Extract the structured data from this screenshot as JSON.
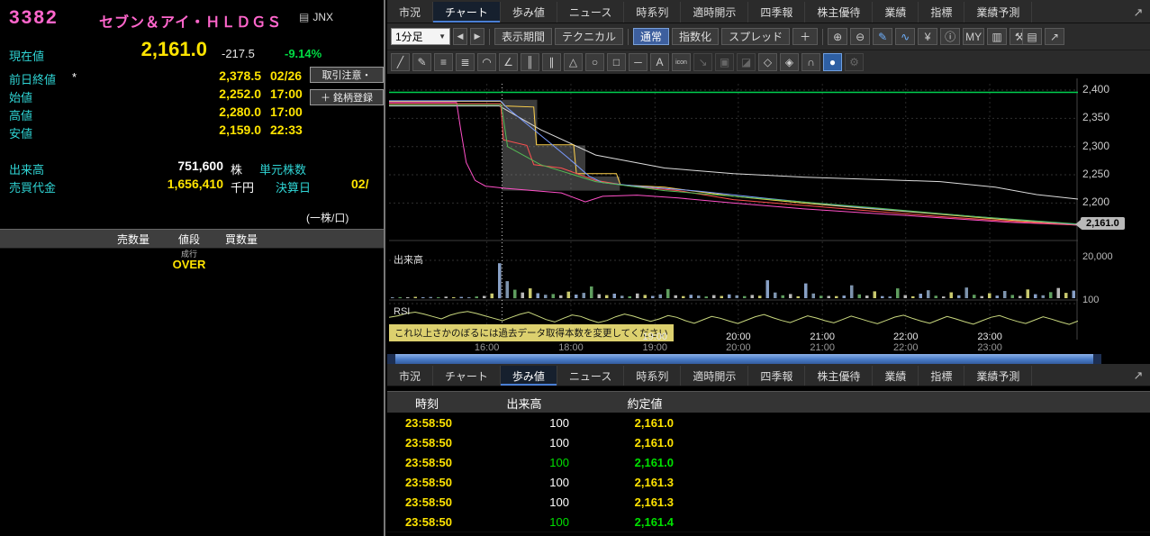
{
  "left": {
    "code": "3382",
    "name": "セブン＆アイ・ＨＬＤＧＳ",
    "board_icon": "▤",
    "exchange": "JNX",
    "current_label": "現在値",
    "current_value": "2,161.0",
    "change": "-217.5",
    "change_pct": "-9.14%",
    "info_rows": [
      {
        "label": "前日終値",
        "mark": "*",
        "value": "2,378.5",
        "extra": "02/26"
      },
      {
        "label": "始値",
        "mark": "",
        "value": "2,252.0",
        "extra": "17:00"
      },
      {
        "label": "高値",
        "mark": "",
        "value": "2,280.0",
        "extra": "17:00"
      },
      {
        "label": "安値",
        "mark": "",
        "value": "2,159.0",
        "extra": "22:33"
      }
    ],
    "volume_label": "出来高",
    "volume_value": "751,600",
    "volume_unit": "株",
    "unit_shares_label": "単元株数",
    "turnover_label": "売買代金",
    "turnover_value": "1,656,410",
    "turnover_unit": "千円",
    "settlement_label": "決算日",
    "settlement_value": "02/",
    "attention_button": "取引注意・",
    "register_button": "＋ 銘柄登録",
    "per_share_note": "(一株/口)",
    "book_headers": [
      "売数量",
      "値段",
      "買数量"
    ],
    "book_market_order": "成行",
    "book_over": "OVER"
  },
  "tabs": {
    "labels": [
      "市況",
      "チャート",
      "歩み値",
      "ニュース",
      "時系列",
      "適時開示",
      "四季報",
      "株主優待",
      "業績",
      "指標",
      "業績予測"
    ],
    "top_selected": 1,
    "bottom_selected": 2,
    "expand_icon": "↗"
  },
  "toolbar": {
    "timeframe": "1分足",
    "caret": "▼",
    "prev": "◀",
    "next": "▶",
    "buttons": [
      "表示期間",
      "テクニカル"
    ],
    "mode_buttons": [
      "通常",
      "指数化",
      "スプレッド"
    ],
    "mode_selected": 0,
    "add_button": "＋",
    "icons": [
      {
        "name": "zoom-in-icon",
        "glyph": "⊕"
      },
      {
        "name": "zoom-out-icon",
        "glyph": "⊖"
      },
      {
        "name": "pen-icon",
        "glyph": "✎",
        "color": "#6fb1ff"
      },
      {
        "name": "wave-icon",
        "glyph": "∿",
        "color": "#6fb1ff"
      },
      {
        "name": "yen-icon",
        "glyph": "¥"
      },
      {
        "name": "info-icon",
        "glyph": "ⓘ"
      },
      {
        "name": "my-indicator-icon",
        "glyph": "MY"
      },
      {
        "name": "bar-chart-icon",
        "glyph": "▥"
      },
      {
        "name": "wrench-icon",
        "glyph": "⚒"
      }
    ],
    "right_icons": [
      {
        "name": "print-icon",
        "glyph": "▤"
      },
      {
        "name": "export-icon",
        "glyph": "↗"
      }
    ],
    "draw_icons": [
      {
        "name": "trendline-icon",
        "glyph": "╱"
      },
      {
        "name": "pencil-icon",
        "glyph": "✎"
      },
      {
        "name": "multi-line-icon",
        "glyph": "≡"
      },
      {
        "name": "parallel-lines-icon",
        "glyph": "≣"
      },
      {
        "name": "arc-icon",
        "glyph": "◠"
      },
      {
        "name": "angle-line-icon",
        "glyph": "∠"
      },
      {
        "name": "vertical-lines-icon",
        "glyph": "║"
      },
      {
        "name": "channel-icon",
        "glyph": "∥"
      },
      {
        "name": "polygon-icon",
        "glyph": "△"
      },
      {
        "name": "circle-icon",
        "glyph": "○"
      },
      {
        "name": "rect-icon",
        "glyph": "□"
      },
      {
        "name": "hline-icon",
        "glyph": "─"
      },
      {
        "name": "text-icon",
        "glyph": "A"
      },
      {
        "name": "stamp-icon",
        "glyph": "icon",
        "small": true
      },
      {
        "name": "arrow-stamp-icon",
        "glyph": "↘",
        "dim": true
      },
      {
        "name": "fill-rect-icon",
        "glyph": "▣",
        "dim": true
      },
      {
        "name": "half-fill-icon",
        "glyph": "◪",
        "dim": true
      },
      {
        "name": "eraser-icon",
        "glyph": "◇"
      },
      {
        "name": "eraser-all-icon",
        "glyph": "◈"
      },
      {
        "name": "magnet-icon",
        "glyph": "∩"
      },
      {
        "name": "lock-icon",
        "glyph": "●",
        "active": true
      },
      {
        "name": "settings-icon",
        "glyph": "⚙",
        "dim": true
      }
    ]
  },
  "chart_data": {
    "type": "line",
    "tooltip": "これ以上さかのぼるには過去データ取得本数を変更してください",
    "y_ticks": {
      "labels": [
        "2,400",
        "2,350",
        "2,300",
        "2,250",
        "2,200"
      ],
      "values": [
        2400,
        2350,
        2300,
        2250,
        2200
      ]
    },
    "price_tag": {
      "label": "2,161.0",
      "value": 2161
    },
    "x_ticks": {
      "labels": [
        "16:00",
        "18:00",
        "19:00",
        "20:00",
        "21:00",
        "22:00",
        "23:00"
      ],
      "pos": [
        0.142,
        0.264,
        0.386,
        0.507,
        0.629,
        0.75,
        0.872
      ]
    },
    "x_ticks_upper": {
      "labels": [
        "19:00",
        "20:00",
        "21:00",
        "22:00",
        "23:00"
      ],
      "pos": [
        0.386,
        0.507,
        0.629,
        0.75,
        0.872
      ]
    },
    "session_start_x": 0.164,
    "panes": {
      "volume_label": "出来高",
      "volume_scale_label": "20,000",
      "volume_max": 20000,
      "rsi_label": "RSI",
      "rsi_scale_label": "100"
    },
    "series": [
      {
        "name": "limit-line",
        "color": "#00d050",
        "width": 1.4,
        "points": [
          [
            0,
            2396
          ],
          [
            1,
            2396
          ]
        ]
      },
      {
        "name": "vwap-line",
        "color": "#dddddd",
        "width": 1,
        "points": [
          [
            0,
            2372
          ],
          [
            0.16,
            2372
          ],
          [
            0.22,
            2330
          ],
          [
            0.3,
            2285
          ],
          [
            0.4,
            2262
          ],
          [
            0.5,
            2252
          ],
          [
            0.6,
            2246
          ],
          [
            0.7,
            2242
          ],
          [
            0.8,
            2238
          ],
          [
            0.88,
            2228
          ],
          [
            0.94,
            2215
          ],
          [
            1,
            2207
          ]
        ]
      },
      {
        "name": "series-pink",
        "color": "#ff50c8",
        "width": 1,
        "points": [
          [
            0,
            2378
          ],
          [
            0.098,
            2378
          ],
          [
            0.104,
            2330
          ],
          [
            0.112,
            2272
          ],
          [
            0.125,
            2240
          ],
          [
            0.14,
            2230
          ],
          [
            0.17,
            2226
          ],
          [
            0.21,
            2222
          ],
          [
            0.25,
            2218
          ],
          [
            0.285,
            2202
          ],
          [
            0.31,
            2212
          ],
          [
            0.36,
            2214
          ],
          [
            0.42,
            2209
          ],
          [
            0.5,
            2200
          ],
          [
            0.6,
            2190
          ],
          [
            0.7,
            2182
          ],
          [
            0.8,
            2174
          ],
          [
            0.9,
            2166
          ],
          [
            1,
            2161
          ]
        ]
      },
      {
        "name": "series-yellow",
        "color": "#ffd24d",
        "width": 1,
        "points": [
          [
            0,
            2380
          ],
          [
            0.162,
            2380
          ],
          [
            0.168,
            2372
          ],
          [
            0.21,
            2370
          ],
          [
            0.214,
            2303
          ],
          [
            0.268,
            2303
          ],
          [
            0.272,
            2252
          ],
          [
            0.33,
            2252
          ],
          [
            0.336,
            2232
          ],
          [
            0.4,
            2228
          ],
          [
            0.5,
            2212
          ],
          [
            0.6,
            2200
          ],
          [
            0.7,
            2190
          ],
          [
            0.8,
            2180
          ],
          [
            0.9,
            2170
          ],
          [
            1,
            2162
          ]
        ]
      },
      {
        "name": "series-red",
        "color": "#ff5050",
        "width": 1,
        "points": [
          [
            0,
            2376
          ],
          [
            0.162,
            2376
          ],
          [
            0.166,
            2312
          ],
          [
            0.2,
            2302
          ],
          [
            0.21,
            2268
          ],
          [
            0.25,
            2262
          ],
          [
            0.3,
            2240
          ],
          [
            0.35,
            2230
          ],
          [
            0.42,
            2222
          ],
          [
            0.5,
            2206
          ],
          [
            0.6,
            2196
          ],
          [
            0.7,
            2186
          ],
          [
            0.8,
            2176
          ],
          [
            0.9,
            2168
          ],
          [
            1,
            2161
          ]
        ]
      },
      {
        "name": "series-blue",
        "color": "#7a9bff",
        "width": 1,
        "points": [
          [
            0,
            2381
          ],
          [
            0.162,
            2381
          ],
          [
            0.17,
            2370
          ],
          [
            0.2,
            2340
          ],
          [
            0.23,
            2310
          ],
          [
            0.26,
            2280
          ],
          [
            0.29,
            2248
          ],
          [
            0.31,
            2236
          ],
          [
            0.36,
            2230
          ],
          [
            0.45,
            2221
          ],
          [
            0.55,
            2208
          ],
          [
            0.65,
            2196
          ],
          [
            0.75,
            2186
          ],
          [
            0.85,
            2176
          ],
          [
            1,
            2162
          ]
        ]
      },
      {
        "name": "series-green",
        "color": "#55bb55",
        "width": 1,
        "points": [
          [
            0,
            2374
          ],
          [
            0.163,
            2374
          ],
          [
            0.172,
            2300
          ],
          [
            0.22,
            2268
          ],
          [
            0.3,
            2238
          ],
          [
            0.4,
            2222
          ],
          [
            0.5,
            2212
          ],
          [
            0.6,
            2202
          ],
          [
            0.7,
            2192
          ],
          [
            0.85,
            2176
          ],
          [
            1,
            2163
          ]
        ]
      }
    ],
    "band": {
      "color": "rgba(170,170,170,0.35)",
      "points": [
        [
          0.164,
          2383
        ],
        [
          0.215,
          2383
        ],
        [
          0.215,
          2302
        ],
        [
          0.285,
          2302
        ],
        [
          0.285,
          2247
        ],
        [
          0.335,
          2247
        ],
        [
          0.335,
          2222
        ],
        [
          0.164,
          2222
        ]
      ]
    },
    "volume_bars": [
      300,
      500,
      400,
      700,
      350,
      600,
      450,
      800,
      500,
      650,
      400,
      900,
      1200,
      2500,
      18500,
      9000,
      4500,
      3000,
      5200,
      2600,
      1800,
      2200,
      1500,
      3500,
      1900,
      2800,
      6200,
      2100,
      1600,
      2400,
      1300,
      1000,
      2500,
      1700,
      1200,
      2000,
      4800,
      1500,
      1100,
      1800,
      1400,
      900,
      1600,
      1200,
      2000,
      1500,
      1100,
      1700,
      1300,
      9500,
      3000,
      1500,
      2200,
      1000,
      7800,
      2500,
      1300,
      1200,
      1100,
      1400,
      6800,
      2000,
      1400,
      3600,
      1100,
      900,
      5200,
      1600,
      1000,
      2400,
      4200,
      1300,
      900,
      3100,
      1500,
      5600,
      1800,
      1100,
      2600,
      1400,
      3800,
      1700,
      1200,
      4600,
      2100,
      1500,
      3200,
      5400,
      2800,
      4000
    ],
    "volume_palette": [
      "#7d93ad",
      "#5f9e5f",
      "#b8b8b8",
      "#c9c96e",
      "#88a0c6"
    ],
    "rsi": [
      55,
      60,
      68,
      72,
      66,
      58,
      50,
      62,
      70,
      74,
      68,
      60,
      52,
      44,
      55,
      65,
      72,
      60,
      48,
      40,
      52,
      63,
      58,
      47,
      38,
      45,
      57,
      66,
      59,
      50,
      42,
      50,
      61,
      55,
      44,
      36,
      47,
      58,
      52,
      43,
      35,
      46,
      57,
      64,
      54,
      45,
      38,
      49,
      60,
      53,
      44,
      37,
      48,
      59,
      51,
      42,
      34,
      45,
      56,
      62,
      52,
      43,
      36,
      47,
      58,
      50,
      41,
      33,
      44,
      55,
      61,
      51,
      42,
      35,
      46,
      57,
      49,
      40,
      32,
      43
    ],
    "rsi_color": "#c9d87e"
  },
  "trades": {
    "headers": [
      "時刻",
      "出来高",
      "約定値"
    ],
    "time_color": "#ffe400",
    "rows": [
      {
        "time": "23:58:50",
        "volume": "100",
        "price": "2,161.0",
        "volume_color": "#ffffff",
        "price_color": "#ffe400"
      },
      {
        "time": "23:58:50",
        "volume": "100",
        "price": "2,161.0",
        "volume_color": "#ffffff",
        "price_color": "#ffe400"
      },
      {
        "time": "23:58:50",
        "volume": "100",
        "price": "2,161.0",
        "volume_color": "#00e000",
        "price_color": "#00e000"
      },
      {
        "time": "23:58:50",
        "volume": "100",
        "price": "2,161.3",
        "volume_color": "#ffffff",
        "price_color": "#ffe400"
      },
      {
        "time": "23:58:50",
        "volume": "100",
        "price": "2,161.3",
        "volume_color": "#ffffff",
        "price_color": "#ffe400"
      },
      {
        "time": "23:58:50",
        "volume": "100",
        "price": "2,161.4",
        "volume_color": "#00e000",
        "price_color": "#00e000"
      }
    ]
  },
  "colors": {
    "pink": "#ff66cc",
    "cyan": "#2fd4d4",
    "yellow": "#ffe400",
    "green": "#00dd44",
    "accent_blue": "#4a7fd4"
  }
}
